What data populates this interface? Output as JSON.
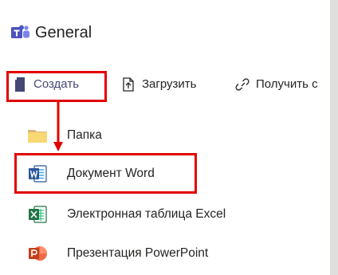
{
  "header": {
    "app_icon": "microsoft-teams-icon",
    "channel_name": "General"
  },
  "toolbar": {
    "create": {
      "label": "Создать",
      "icon": "new-document-icon"
    },
    "upload": {
      "label": "Загрузить",
      "icon": "upload-icon"
    },
    "get_link": {
      "label": "Получить с",
      "icon": "link-icon"
    }
  },
  "new_menu": {
    "items": [
      {
        "label": "Папка",
        "icon": "folder-icon"
      },
      {
        "label": "Документ Word",
        "icon": "word-icon"
      },
      {
        "label": "Электронная таблица Excel",
        "icon": "excel-icon"
      },
      {
        "label": "Презентация PowerPoint",
        "icon": "powerpoint-icon"
      }
    ]
  },
  "annotation": {
    "highlight_color": "#e30000"
  }
}
